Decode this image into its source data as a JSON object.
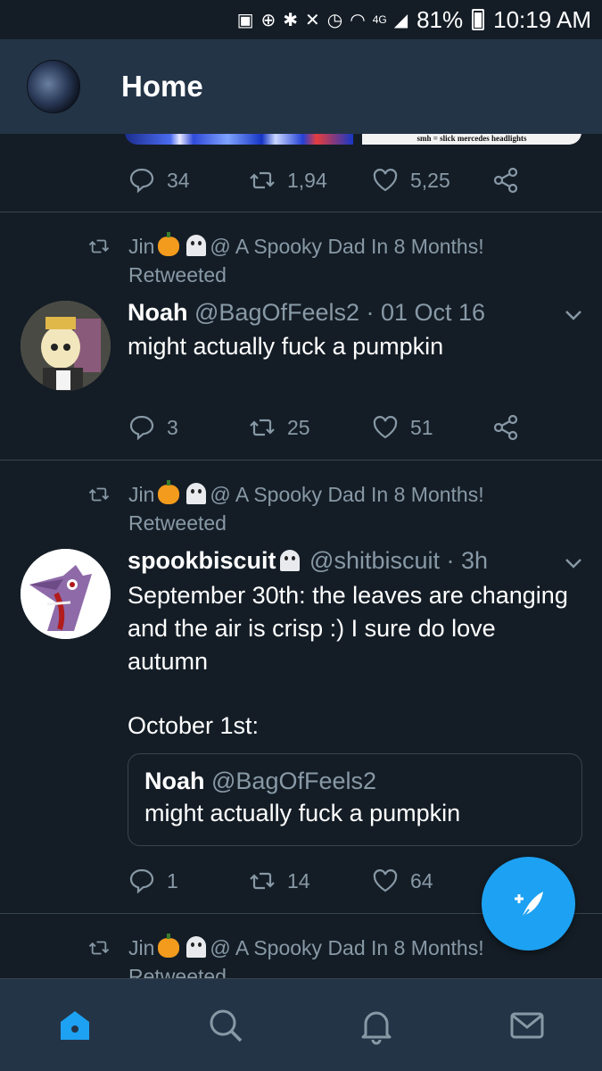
{
  "status_bar": {
    "network": "4G",
    "battery": "81%",
    "time": "10:19 AM"
  },
  "header": {
    "title": "Home"
  },
  "previous_tweet": {
    "media_caption": "smh = slick mercedes headlights",
    "replies": "34",
    "retweets": "1,94",
    "likes": "5,25"
  },
  "tweets": [
    {
      "retweet_by": "Jin",
      "retweet_suffix": "@ A Spooky Dad In 8 Months!",
      "retweet_label": "Retweeted",
      "name": "Noah",
      "handle": "@BagOfFeels2 · 01 Oct 16",
      "text": "might actually fuck a pumpkin",
      "replies": "3",
      "retweets": "25",
      "likes": "51"
    },
    {
      "retweet_by": "Jin",
      "retweet_suffix": "@ A Spooky Dad In 8 Months!",
      "retweet_label": "Retweeted",
      "name": "spookbiscuit",
      "handle": "@shitbiscuit · 3h",
      "text_line1": "September 30th: the leaves are changing",
      "text_line2": "and the air is crisp :) I sure do love",
      "text_line3": "autumn",
      "text_line4": "October 1st:",
      "quote_name": "Noah",
      "quote_handle": "@BagOfFeels2",
      "quote_text": "might actually fuck a pumpkin",
      "replies": "1",
      "retweets": "14",
      "likes": "64"
    },
    {
      "retweet_by": "Jin",
      "retweet_suffix": "@ A Spooky Dad In 8 Months!",
      "retweet_label": "Retweeted"
    }
  ],
  "icons": {
    "reply": "reply-icon",
    "retweet": "retweet-icon",
    "like": "heart-icon",
    "share": "share-icon",
    "compose": "compose-tweet-icon",
    "nav": [
      "home-icon",
      "search-icon",
      "notifications-icon",
      "messages-icon"
    ]
  },
  "colors": {
    "background": "#141d26",
    "header": "#243447",
    "accent": "#1da1f2",
    "muted": "#8899a6"
  }
}
